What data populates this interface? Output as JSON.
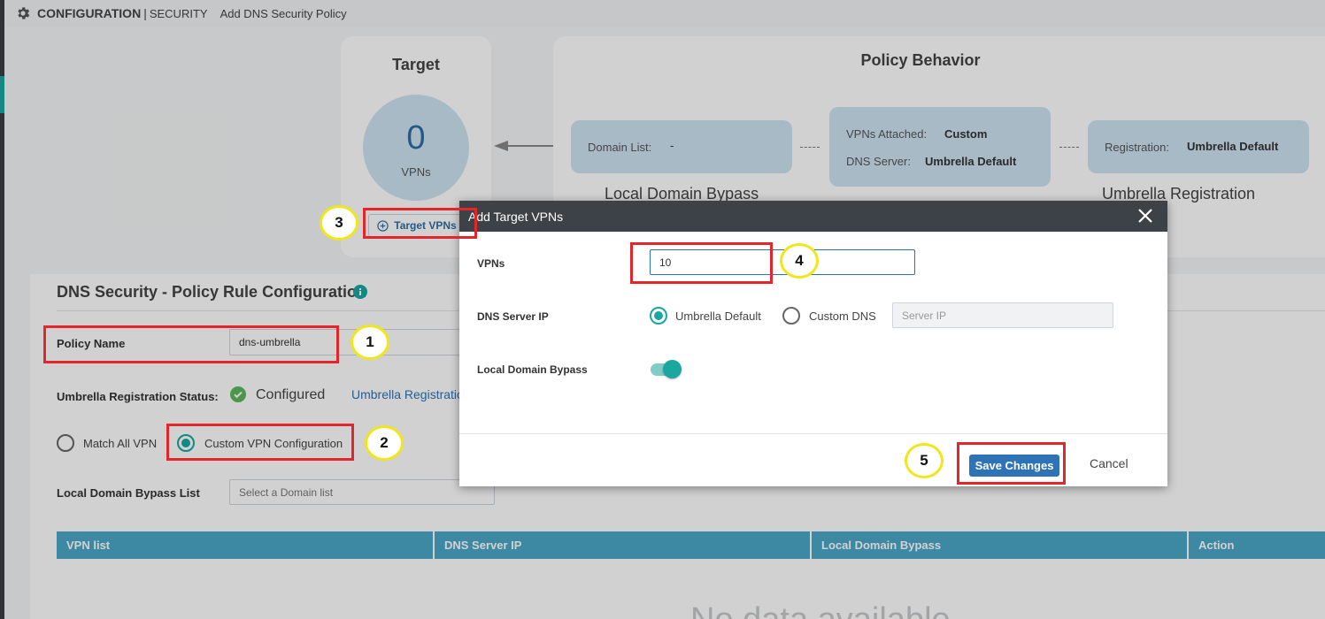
{
  "breadcrumb": {
    "section": "CONFIGURATION",
    "separator": "|",
    "subsection": "SECURITY",
    "page": "Add DNS Security Policy"
  },
  "target": {
    "title": "Target",
    "count": "0",
    "unit": "VPNs",
    "button_label": "Target VPNs"
  },
  "policy_behavior": {
    "title": "Policy Behavior",
    "local_domain_bypass": {
      "key": "Domain List:",
      "value": "-",
      "caption": "Local Domain Bypass"
    },
    "middle": {
      "vpns_key": "VPNs Attached:",
      "vpns_value": "Custom",
      "dns_key": "DNS Server:",
      "dns_value": "Umbrella Default"
    },
    "umbrella": {
      "key": "Registration:",
      "value": "Umbrella Default",
      "caption": "Umbrella Registration"
    }
  },
  "rule_config": {
    "title": "DNS Security - Policy Rule Configuration",
    "policy_name_label": "Policy Name",
    "policy_name_value": "dns-umbrella",
    "reg_status_label": "Umbrella Registration Status:",
    "reg_status_value": "Configured",
    "reg_link": "Umbrella Registratio",
    "match_all_label": "Match All VPN",
    "custom_vpn_label": "Custom VPN Configuration",
    "bypass_list_label": "Local Domain Bypass List",
    "bypass_list_placeholder": "Select a Domain list"
  },
  "table": {
    "columns": [
      "VPN list",
      "DNS Server IP",
      "Local Domain Bypass",
      "Action"
    ],
    "empty_text": "No data available"
  },
  "modal": {
    "title": "Add Target VPNs",
    "vpns_label": "VPNs",
    "vpns_value": "10",
    "dns_label": "DNS Server IP",
    "umbrella_default": "Umbrella Default",
    "custom_dns": "Custom DNS",
    "server_ip_placeholder": "Server IP",
    "bypass_label": "Local Domain Bypass",
    "bypass_on": true,
    "save_label": "Save Changes",
    "cancel_label": "Cancel"
  },
  "annotations": [
    "1",
    "2",
    "3",
    "4",
    "5"
  ],
  "colors": {
    "accent": "#19a7a0",
    "primary": "#2e73b6",
    "highlight_rect": "#e3262b",
    "highlight_circle": "#f1e619",
    "table_header": "#4ba8c7"
  }
}
